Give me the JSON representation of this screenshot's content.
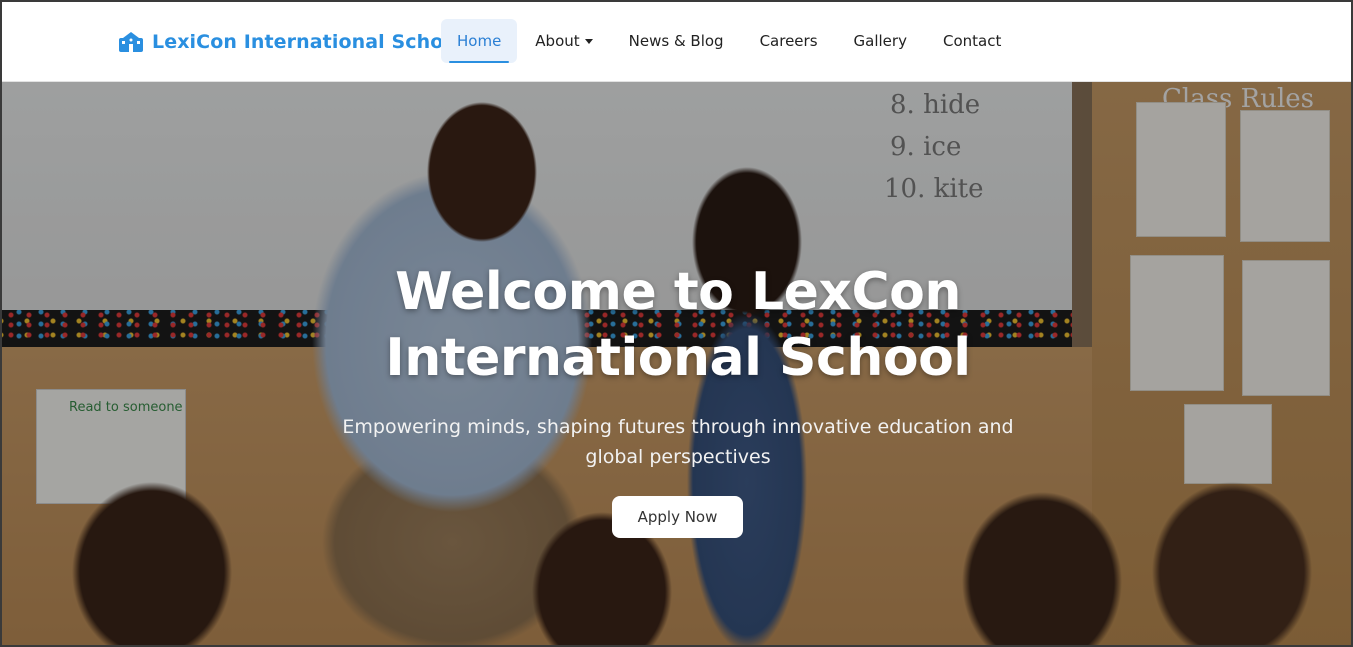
{
  "brand": {
    "name": "LexiCon International School",
    "icon": "school-icon",
    "color": "#2a8fe0"
  },
  "nav": {
    "items": [
      {
        "label": "Home",
        "active": true
      },
      {
        "label": "About",
        "dropdown": true
      },
      {
        "label": "News & Blog"
      },
      {
        "label": "Careers"
      },
      {
        "label": "Gallery"
      },
      {
        "label": "Contact"
      }
    ]
  },
  "hero": {
    "title": "Welcome to LexCon International School",
    "subtitle": "Empowering minds, shaping futures through innovative education and global perspectives",
    "cta_label": "Apply Now"
  },
  "background_art": {
    "board_words": [
      "8. hide",
      "9. ice",
      "10. kite"
    ],
    "class_rules_heading": "Class Rules",
    "left_poster_heading": "Read to someone"
  },
  "colors": {
    "accent": "#2a8fe0",
    "active_nav_bg": "#e9f1fb"
  }
}
